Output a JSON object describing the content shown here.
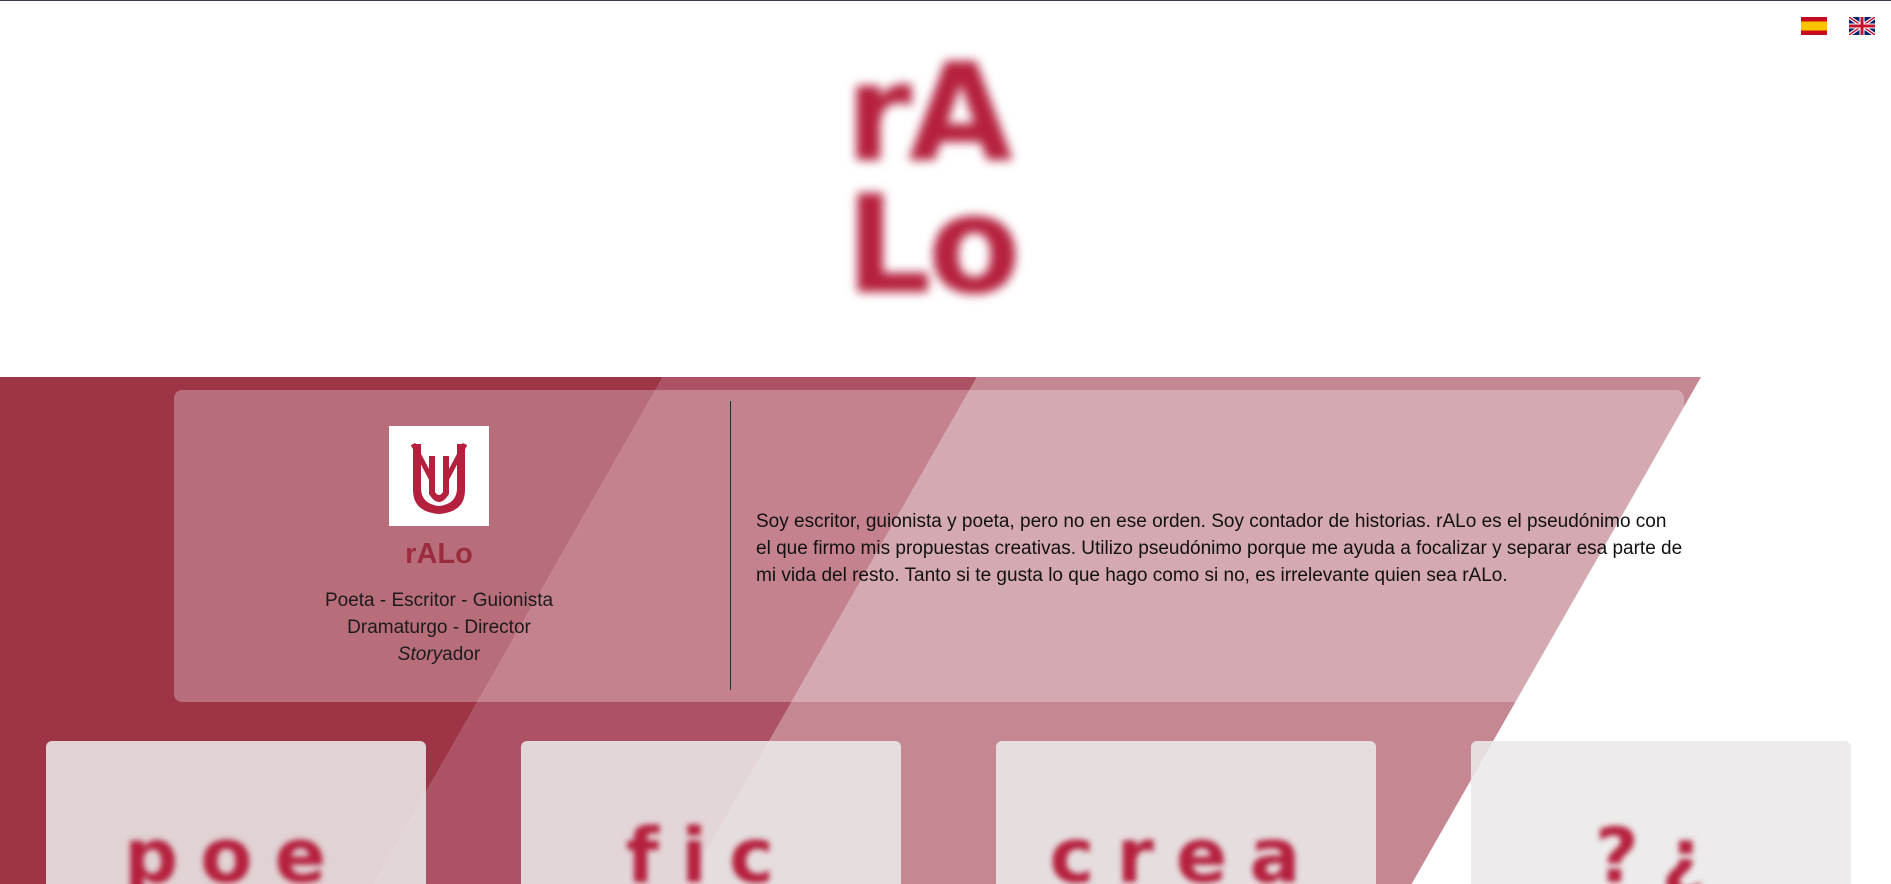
{
  "brand": {
    "color": "#b5203e",
    "logo_line_1": "rA",
    "logo_line_2": "Lo"
  },
  "languages": [
    {
      "code": "es",
      "icon": "spain-flag-icon"
    },
    {
      "code": "en",
      "icon": "uk-flag-icon"
    }
  ],
  "profile": {
    "avatar_icon": "ralo-monogram-icon",
    "name": "rALo",
    "roles_line_1": "Poeta - Escritor - Guionista",
    "roles_line_2": "Dramaturgo - Director",
    "roles_line_3_italic": "Story",
    "roles_line_3_rest": "ador"
  },
  "bio": "Soy escritor, guionista y poeta, pero no en ese orden. Soy contador de historias. rALo es el pseudónimo con el que firmo mis propuestas creativas. Utilizo pseudónimo porque me ayuda a focalizar y separar esa parte de mi vida del resto. Tanto si te gusta lo que hago como si no, es irrelevante quien sea rALo.",
  "sections": [
    {
      "label": "poe"
    },
    {
      "label": "fic"
    },
    {
      "label": "crea"
    },
    {
      "label": "?¿"
    }
  ],
  "colors": {
    "band_dark": "#9d3547",
    "band_mid": "#ad5264",
    "band_light": "#c58893",
    "card_bg": "#e3dfdf"
  }
}
